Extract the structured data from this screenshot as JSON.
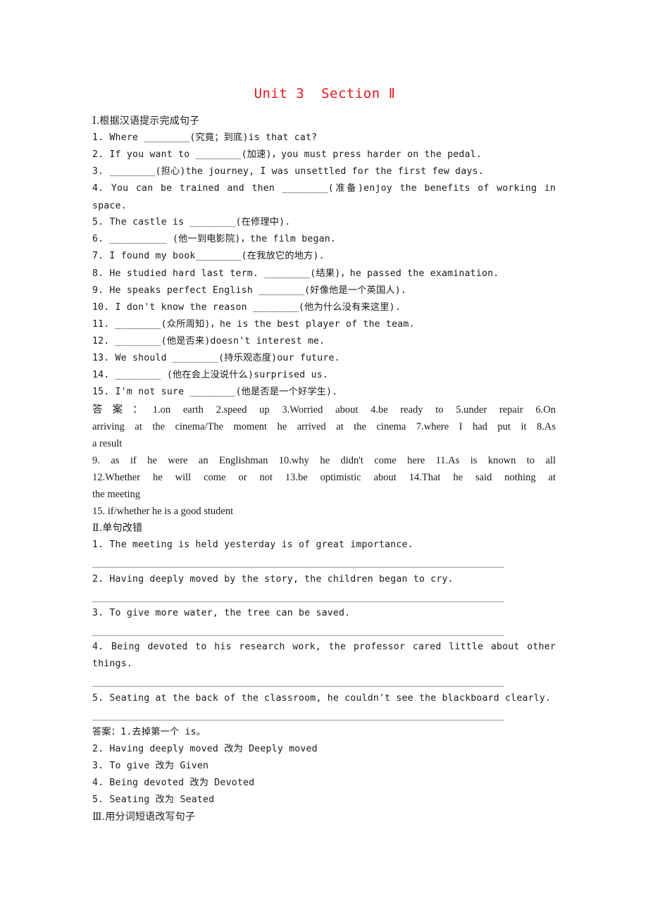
{
  "title": "Unit 3  Section Ⅱ",
  "part1": {
    "heading": "Ⅰ.根据汉语提示完成句子",
    "items": [
      "1. Where ________(究竟；到底)is that cat?",
      "2. If you want to ________(加速)，you must press harder on the pedal.",
      "3. ________(担心)the journey, I was unsettled for the first few days.",
      "4. You can be trained and then ________(准备)enjoy the benefits of working in",
      "space.",
      "5. The castle is ________(在修理中).",
      "6. __________ (他一到电影院)，the film began.",
      "7. I found my book________(在我放它的地方).",
      "8. He studied hard last term. ________(结果)，he passed the examination.",
      "9. He speaks perfect English ________(好像他是一个英国人).",
      "10. I don't know the reason ________(他为什么没有来这里).",
      "11. ________(众所周知)，he is the best player of the team.",
      "12. ________(他是否来)doesn't interest me.",
      "13. We should ________(持乐观态度)our future.",
      "14. ________ (他在会上没说什么)surprised us.",
      "15. I'm not sure ________(他是否是一个好学生)."
    ],
    "answers": [
      "答案：1.on earth  2.speed up  3.Worried about  4.be ready to  5.under repair  6.On",
      "arriving at the cinema/The moment he arrived at the cinema  7.where I had put it  8.As",
      "a result",
      "9. as if he were an Englishman  10.why he didn't come here  11.As is known to all",
      "12.Whether he will come or not  13.be optimistic about  14.That he said nothing at",
      "the meeting",
      "15. if/whether he is a good student"
    ]
  },
  "part2": {
    "heading": "Ⅱ.单句改错",
    "items": [
      "1. The meeting is held yesterday is of great importance.",
      "2. Having deeply moved by the story, the children began to cry.",
      "3. To give more water, the tree can be saved.",
      "4. Being devoted to his research work, the professor cared little about other",
      "things.",
      "5. Seating at the back of the classroom, he couldn't see the blackboard clearly."
    ],
    "answers": [
      "答案：1.去掉第一个 is。",
      "2. Having deeply moved 改为 Deeply moved",
      "3. To give 改为 Given",
      "4. Being devoted 改为 Devoted",
      "5. Seating 改为 Seated"
    ]
  },
  "part3": {
    "heading": "Ⅲ.用分词短语改写句子"
  }
}
